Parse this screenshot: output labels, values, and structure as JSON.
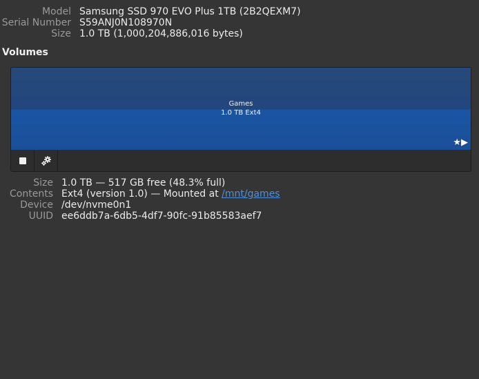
{
  "disk": {
    "model_label": "Model",
    "model_value": "Samsung SSD 970 EVO Plus 1TB (2B2QEXM7)",
    "serial_label": "Serial Number",
    "serial_value": "S59ANJ0N108970N",
    "size_label": "Size",
    "size_value": "1.0 TB (1,000,204,886,016 bytes)"
  },
  "volumes": {
    "title": "Volumes",
    "partition": {
      "name": "Games",
      "size": "1.0 TB Ext4",
      "flags": "★▶",
      "color": "#1b55a3"
    }
  },
  "toolbar": {
    "stop_icon": "stop-square-icon",
    "settings_icon": "gears-icon"
  },
  "details": {
    "size_label": "Size",
    "size_value": "1.0 TB — 517 GB free (48.3% full)",
    "contents_label": "Contents",
    "contents_prefix": "Ext4 (version 1.0) — Mounted at ",
    "mount_link": "/mnt/games",
    "device_label": "Device",
    "device_value": "/dev/nvme0n1",
    "uuid_label": "UUID",
    "uuid_value": "ee6ddb7a-6db5-4df7-90fc-91b85583aef7"
  }
}
